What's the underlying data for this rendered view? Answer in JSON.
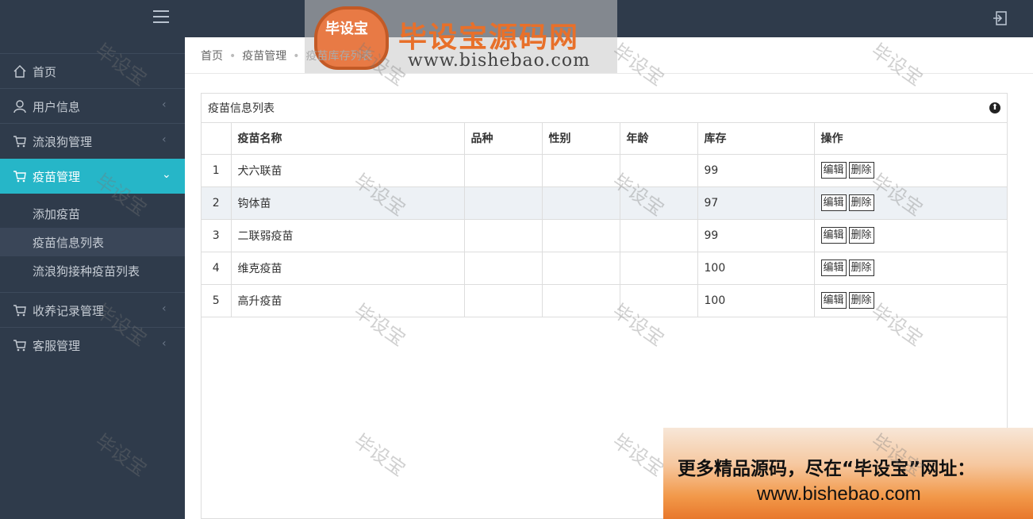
{
  "header": {
    "logo_badge": "毕设宝",
    "logo_title": "毕设宝源码网",
    "logo_url": "www.bishebao.com"
  },
  "sidebar": {
    "items": [
      {
        "label": "首页",
        "icon": "home-icon"
      },
      {
        "label": "用户信息",
        "icon": "user-icon"
      },
      {
        "label": "流浪狗管理",
        "icon": "cart-icon"
      },
      {
        "label": "疫苗管理",
        "icon": "cart-icon"
      },
      {
        "label": "收养记录管理",
        "icon": "cart-icon"
      },
      {
        "label": "客服管理",
        "icon": "cart-icon"
      }
    ],
    "subitems": [
      {
        "label": "添加疫苗"
      },
      {
        "label": "疫苗信息列表"
      },
      {
        "label": "流浪狗接种疫苗列表"
      }
    ],
    "chevron_collapsed": "‹",
    "chevron_expanded": "⌄"
  },
  "breadcrumb": {
    "home": "首页",
    "section": "疫苗管理",
    "current": "疫苗库存列表",
    "separator": "•"
  },
  "panel": {
    "title": "疫苗信息列表",
    "collapse_glyph": "⬆"
  },
  "table": {
    "columns": [
      "",
      "疫苗名称",
      "品种",
      "性别",
      "年龄",
      "库存",
      "操作"
    ],
    "rows": [
      {
        "idx": "1",
        "name": "犬六联苗",
        "breed": "",
        "gender": "",
        "age": "",
        "stock": "99"
      },
      {
        "idx": "2",
        "name": "钩体苗",
        "breed": "",
        "gender": "",
        "age": "",
        "stock": "97"
      },
      {
        "idx": "3",
        "name": "二联弱疫苗",
        "breed": "",
        "gender": "",
        "age": "",
        "stock": "99"
      },
      {
        "idx": "4",
        "name": "维克疫苗",
        "breed": "",
        "gender": "",
        "age": "",
        "stock": "100"
      },
      {
        "idx": "5",
        "name": "高升疫苗",
        "breed": "",
        "gender": "",
        "age": "",
        "stock": "100"
      }
    ],
    "edit_label": "编辑",
    "delete_label": "删除"
  },
  "watermark": "毕设宝",
  "promo": {
    "line1": "更多精品源码，尽在“毕设宝”网址：",
    "line2": "www.bishebao.com"
  },
  "colors": {
    "sidebar_bg": "#2f3b4b",
    "active_accent": "#26b6c8",
    "stripe_row": "#edf1f5"
  }
}
